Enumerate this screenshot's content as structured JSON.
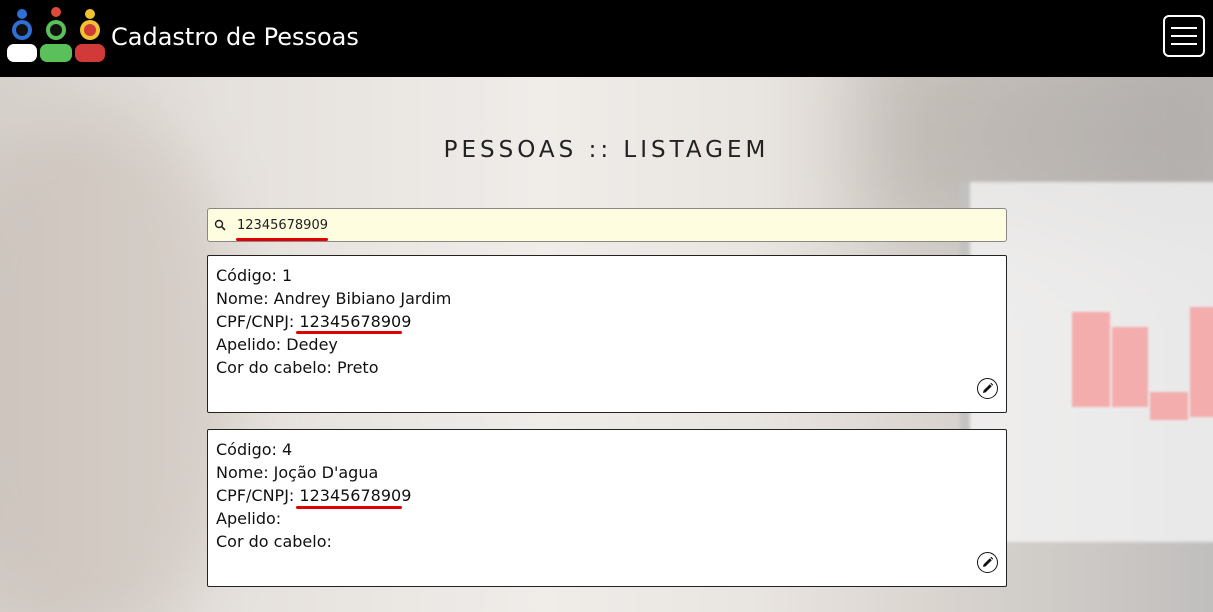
{
  "header": {
    "title": "Cadastro de Pessoas",
    "logo_icon": "people-group-icon",
    "menu_icon": "hamburger-menu-icon"
  },
  "page": {
    "heading": "PESSOAS :: LISTAGEM"
  },
  "search": {
    "value": "12345678909",
    "icon": "search-icon",
    "background": "#fffde0"
  },
  "highlight_color": "#e00000",
  "records": [
    {
      "codigo_label": "Código:",
      "codigo": "1",
      "nome_label": "Nome:",
      "nome": "Andrey Bibiano Jardim",
      "cpf_label": "CPF/CNPJ:",
      "cpf": "12345678909",
      "apelido_label": "Apelido:",
      "apelido": "Dedey",
      "cabelo_label": "Cor do cabelo:",
      "cabelo": "Preto",
      "edit_icon": "pencil-icon"
    },
    {
      "codigo_label": "Código:",
      "codigo": "4",
      "nome_label": "Nome:",
      "nome": "Joção D'agua",
      "cpf_label": "CPF/CNPJ:",
      "cpf": "12345678909",
      "apelido_label": "Apelido:",
      "apelido": "",
      "cabelo_label": "Cor do cabelo:",
      "cabelo": "",
      "edit_icon": "pencil-icon"
    }
  ]
}
